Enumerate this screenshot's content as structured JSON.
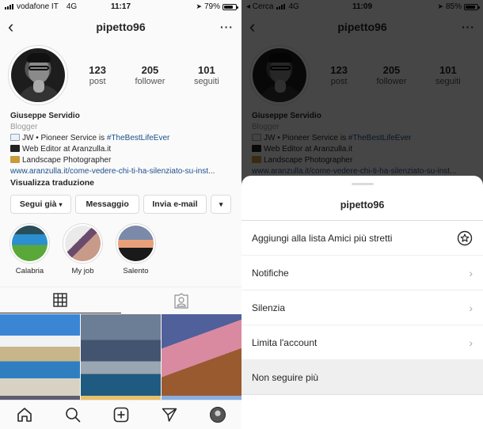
{
  "left": {
    "status": {
      "carrier": "vodafone IT",
      "network": "4G",
      "time": "11:17",
      "battery": "79%",
      "battery_level": 0.79
    },
    "nav": {
      "back": "‹",
      "username": "pipetto96",
      "more": "···"
    },
    "stats": [
      {
        "value": "123",
        "label": "post"
      },
      {
        "value": "205",
        "label": "follower"
      },
      {
        "value": "101",
        "label": "seguiti"
      }
    ],
    "bio": {
      "name": "Giuseppe Servidio",
      "category": "Blogger",
      "line1_text": "JW • Pioneer Service is ",
      "line1_hashtag": "#TheBestLifeEver",
      "line2": "Web Editor at Aranzulla.it",
      "line3": "Landscape Photographer",
      "link": "www.aranzulla.it/come-vedere-chi-ti-ha-silenziato-su-inst...",
      "translate": "Visualizza traduzione"
    },
    "actions": {
      "follow": "Segui già",
      "message": "Messaggio",
      "email": "Invia e-mail",
      "dropdown": "⌄"
    },
    "highlights": [
      {
        "label": "Calabria"
      },
      {
        "label": "My job"
      },
      {
        "label": "Salento"
      }
    ],
    "tabs": [
      "grid",
      "tagged"
    ],
    "tabbar": [
      "home",
      "search",
      "new-post",
      "direct",
      "profile"
    ]
  },
  "right": {
    "status": {
      "back_app": "◂ Cerca",
      "network": "4G",
      "time": "11:09",
      "battery": "85%",
      "battery_level": 0.85
    },
    "nav": {
      "back": "‹",
      "username": "pipetto96",
      "more": "···"
    },
    "stats": [
      {
        "value": "123",
        "label": "post"
      },
      {
        "value": "205",
        "label": "follower"
      },
      {
        "value": "101",
        "label": "seguiti"
      }
    ],
    "bio": {
      "name": "Giuseppe Servidio",
      "category": "Blogger",
      "line1_text": "JW • Pioneer Service is ",
      "line1_hashtag": "#TheBestLifeEver",
      "line2": "Web Editor at Aranzulla.it",
      "line3": "Landscape Photographer",
      "link": "www.aranzulla.it/come-vedere-chi-ti-ha-silenziato-su-inst..."
    },
    "sheet": {
      "title": "pipetto96",
      "items": [
        {
          "label": "Aggiungi alla lista Amici più stretti",
          "icon": "star-circle-icon"
        },
        {
          "label": "Notifiche",
          "icon": "chevron-right-icon"
        },
        {
          "label": "Silenzia",
          "icon": "chevron-right-icon"
        },
        {
          "label": "Limita l'account",
          "icon": "chevron-right-icon"
        },
        {
          "label": "Non seguire più",
          "icon": ""
        }
      ]
    }
  }
}
